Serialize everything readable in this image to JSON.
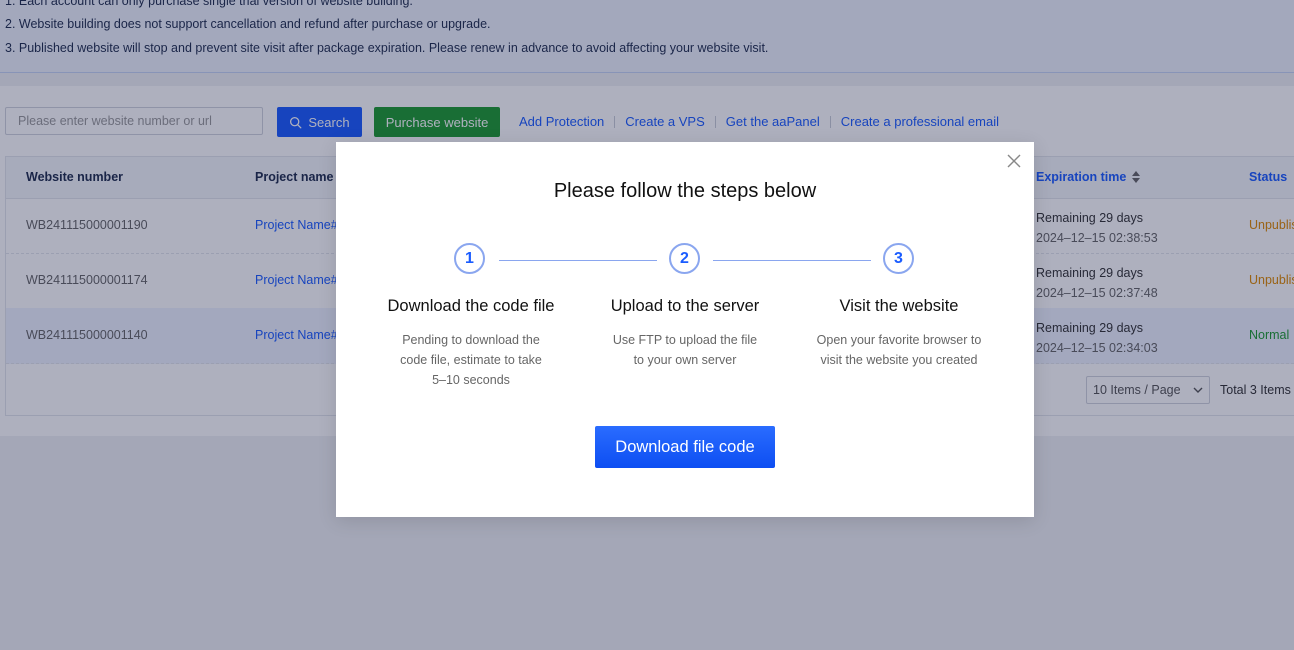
{
  "notice": {
    "line1": "1. Each account can only purchase single trial version of website building.",
    "line2": "2. Website building does not support cancellation and refund after purchase or upgrade.",
    "line3": "3. Published website will stop and prevent site visit after package expiration. Please renew in advance to avoid affecting your website visit."
  },
  "toolbar": {
    "search_placeholder": "Please enter website number or url",
    "search_label": "Search",
    "purchase_label": "Purchase website",
    "links": [
      "Add Protection",
      "Create a VPS",
      "Get the aaPanel",
      "Create a professional email"
    ]
  },
  "table": {
    "headers": {
      "website_number": "Website number",
      "project_name": "Project name",
      "expiration_time": "Expiration time",
      "status": "Status"
    },
    "rows": [
      {
        "number": "WB241115000001190",
        "project": "Project Name#",
        "remaining": "Remaining 29 days",
        "date": "2024–12–15 02:38:53",
        "status": "Unpublis"
      },
      {
        "number": "WB241115000001174",
        "project": "Project Name#",
        "remaining": "Remaining 29 days",
        "date": "2024–12–15 02:37:48",
        "status": "Unpublis"
      },
      {
        "number": "WB241115000001140",
        "project": "Project Name#",
        "remaining": "Remaining 29 days",
        "date": "2024–12–15 02:34:03",
        "status": "Normal"
      }
    ]
  },
  "pagination": {
    "page_size": "10 Items / Page",
    "total": "Total 3 Items"
  },
  "modal": {
    "title": "Please follow the steps below",
    "steps": [
      {
        "number": "1",
        "title": "Download the code file",
        "desc": "Pending to download the code file, estimate to take 5–10 seconds"
      },
      {
        "number": "2",
        "title": "Upload to the server",
        "desc": "Use FTP to upload the file to your own server"
      },
      {
        "number": "3",
        "title": "Visit the website",
        "desc": "Open your favorite browser to visit the website you created"
      }
    ],
    "button_label": "Download file code"
  },
  "colors": {
    "primary": "#1a5cff",
    "success": "#1e9c2f",
    "warning": "#e08a00"
  },
  "icons": {
    "search": "search-icon",
    "sort": "sort-icon",
    "close": "close-icon",
    "dropdown": "chevron-down-icon"
  }
}
